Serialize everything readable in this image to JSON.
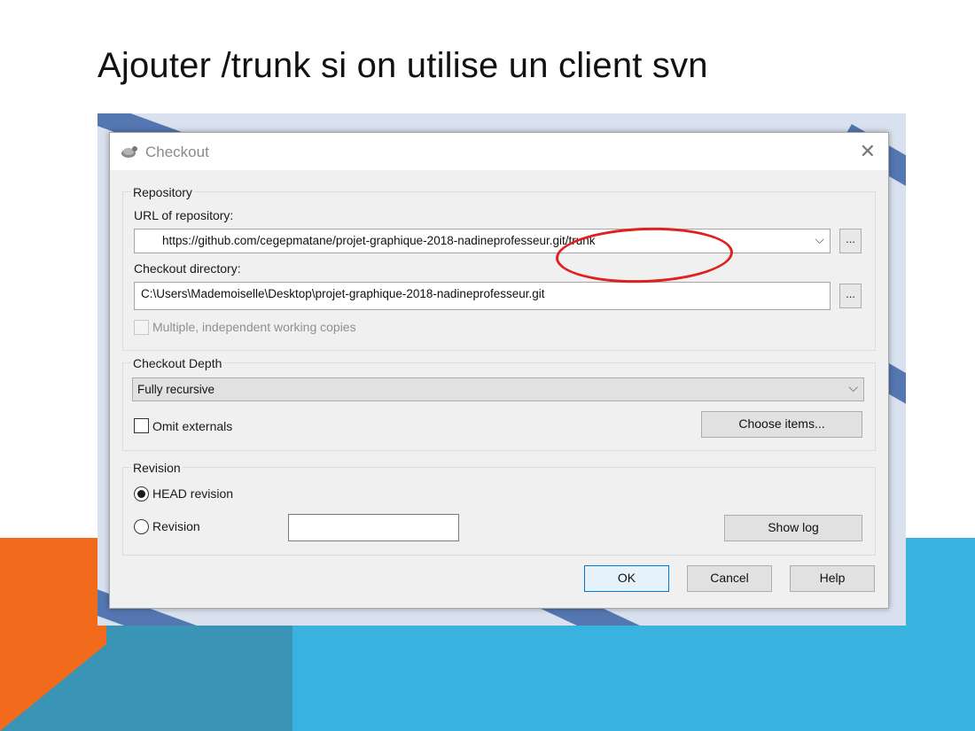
{
  "slide": {
    "title": "Ajouter /trunk si on utilise un client svn"
  },
  "dialog": {
    "title": "Checkout",
    "icons": {
      "app": "tortoise-icon",
      "close": "close-icon"
    },
    "repository": {
      "group_label": "Repository",
      "url_label": "URL of repository:",
      "url_value": "https://github.com/cegepmatane/projet-graphique-2018-nadineprofesseur.git/trunk",
      "browse_label": "...",
      "checkout_dir_label": "Checkout directory:",
      "checkout_dir_value": "C:\\Users\\Mademoiselle\\Desktop\\projet-graphique-2018-nadineprofesseur.git",
      "multiple_label": "Multiple, independent working copies",
      "multiple_checked": false,
      "multiple_enabled": false
    },
    "depth": {
      "group_label": "Checkout Depth",
      "selected": "Fully recursive",
      "omit_externals_label": "Omit externals",
      "omit_externals_checked": false,
      "choose_items_label": "Choose items..."
    },
    "revision": {
      "group_label": "Revision",
      "head_label": "HEAD revision",
      "head_selected": true,
      "revision_label": "Revision",
      "revision_value": "",
      "show_log_label": "Show log"
    },
    "buttons": {
      "ok": "OK",
      "cancel": "Cancel",
      "help": "Help"
    }
  },
  "colors": {
    "orange": "#f26b1d",
    "teal": "#3a94b5",
    "blue": "#39b2df",
    "annotation": "#e0201e"
  }
}
